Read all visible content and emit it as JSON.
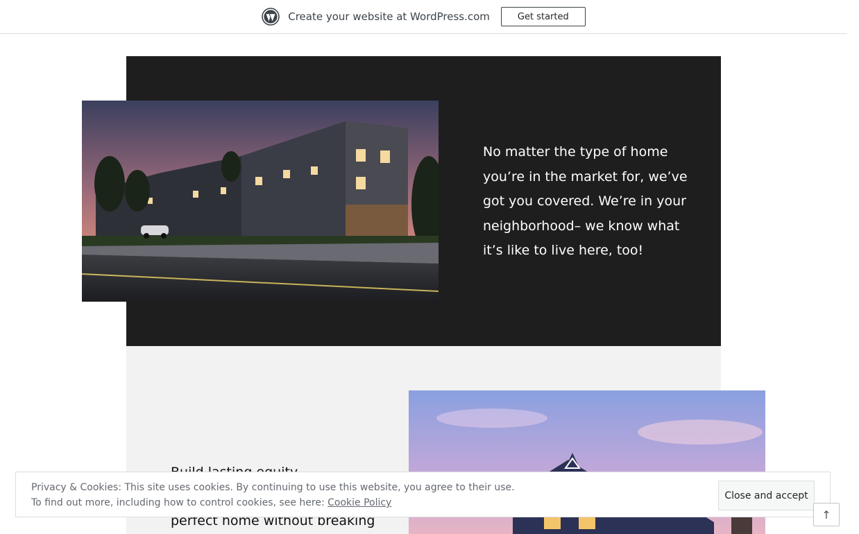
{
  "promo_bar": {
    "text": "Create your website at WordPress.com",
    "button_label": "Get started",
    "icon": "wordpress-logo-icon"
  },
  "dark_section": {
    "background": "#1e1e1e",
    "text": "No matter the type of home you’re in the market for, we’ve got you covered. We’re in your neighborhood– we know what it’s like to live here, too!",
    "image": "townhouse-row-dusk-photo"
  },
  "light_section": {
    "background": "#f2f2f2",
    "text": "Build lasting equity ...",
    "visible_text_line": "perfect home  without breaking",
    "image": "suburban-house-dusk-photo"
  },
  "cookie_banner": {
    "line1": "Privacy & Cookies: This site uses cookies. By continuing to use this website, you agree to their use.",
    "line2_prefix": "To find out more, including how to control cookies, see here: ",
    "link_label": "Cookie Policy",
    "button_label": "Close and accept"
  },
  "scroll_top": {
    "icon": "arrow-up-icon",
    "glyph": "↑"
  }
}
